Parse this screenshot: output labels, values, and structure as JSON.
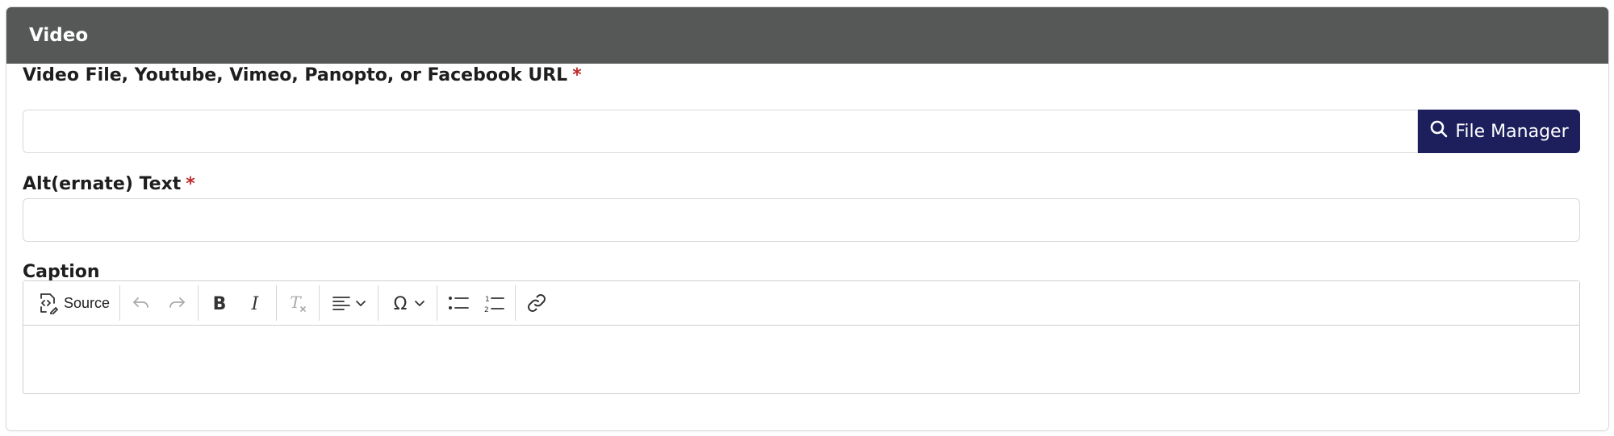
{
  "panel": {
    "title": "Video"
  },
  "video_field": {
    "label": "Video File, Youtube, Vimeo, Panopto, or Facebook URL",
    "required_mark": "*",
    "value": "",
    "button_label": "File Manager",
    "button_icon": "search-icon"
  },
  "alt_field": {
    "label": "Alt(ernate) Text",
    "required_mark": "*",
    "value": ""
  },
  "caption_field": {
    "label": "Caption",
    "toolbar": {
      "source_label": "Source",
      "buttons": [
        "source-icon",
        "undo-icon",
        "redo-icon",
        "bold-icon",
        "italic-icon",
        "remove-format-icon",
        "align-icon",
        "special-characters-icon",
        "bulleted-list-icon",
        "numbered-list-icon",
        "link-icon"
      ]
    },
    "content": ""
  },
  "colors": {
    "header_bg": "#565857",
    "button_bg": "#1c1f5c",
    "required": "#c02b2b"
  }
}
